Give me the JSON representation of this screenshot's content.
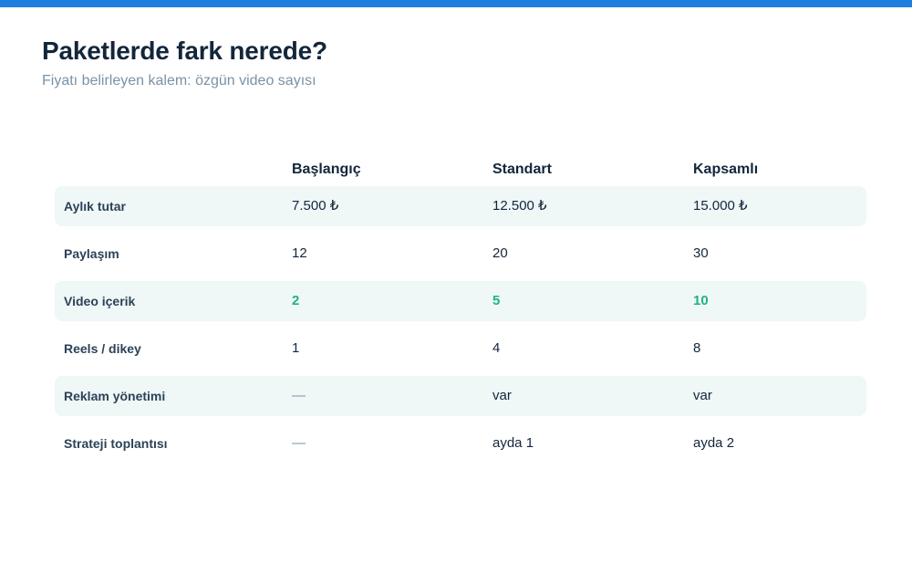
{
  "header": {
    "title": "Paketlerde fark nerede?",
    "subtitle": "Fiyatı belirleyen kalem: özgün video sayısı"
  },
  "colors": {
    "top_bar": "#1f7fe0",
    "accent": "#1fb383",
    "row_shade": "#eff7f7",
    "text_dark": "#13263b",
    "text_muted": "#7a92a6"
  },
  "table": {
    "columns": [
      "Başlangıç",
      "Standart",
      "Kapsamlı"
    ],
    "rows": [
      {
        "label": "Aylık tutar",
        "values": [
          "7.500 ₺",
          "12.500 ₺",
          "15.000 ₺"
        ],
        "shaded": true,
        "accent": false
      },
      {
        "label": "Paylaşım",
        "values": [
          "12",
          "20",
          "30"
        ],
        "shaded": false,
        "accent": false
      },
      {
        "label": "Video içerik",
        "values": [
          "2",
          "5",
          "10"
        ],
        "shaded": true,
        "accent": true
      },
      {
        "label": "Reels / dikey",
        "values": [
          "1",
          "4",
          "8"
        ],
        "shaded": false,
        "accent": false
      },
      {
        "label": "Reklam yönetimi",
        "values": [
          "—",
          "var",
          "var"
        ],
        "shaded": true,
        "accent": false
      },
      {
        "label": "Strateji toplantısı",
        "values": [
          "—",
          "ayda 1",
          "ayda 2"
        ],
        "shaded": false,
        "accent": false
      }
    ]
  }
}
